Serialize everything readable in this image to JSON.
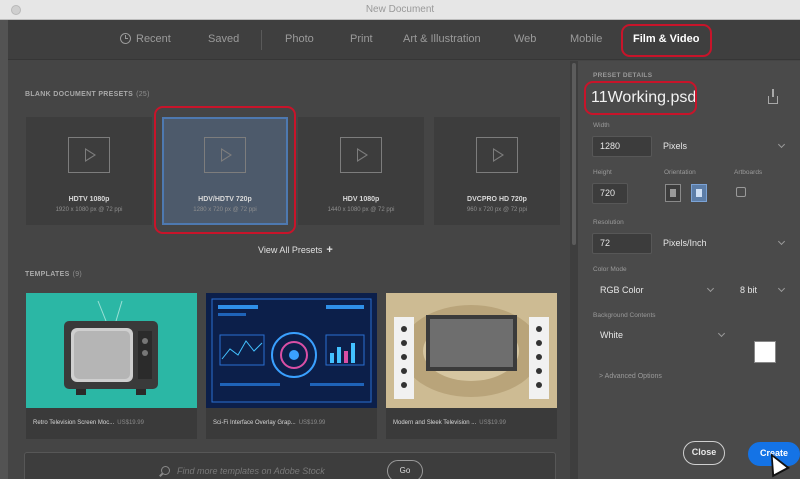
{
  "app": {
    "title": "New Document"
  },
  "tabs": {
    "recent": "Recent",
    "saved": "Saved",
    "photo": "Photo",
    "print": "Print",
    "art": "Art & Illustration",
    "web": "Web",
    "mobile": "Mobile",
    "film": "Film & Video",
    "active": "Film & Video"
  },
  "presets": {
    "title": "BLANK DOCUMENT PRESETS",
    "count": "(25)",
    "items": [
      {
        "name": "HDTV 1080p",
        "dims": "1920 x 1080 px @ 72 ppi"
      },
      {
        "name": "HDV/HDTV 720p",
        "dims": "1280 x 720 px @ 72 ppi"
      },
      {
        "name": "HDV 1080p",
        "dims": "1440 x 1080 px @ 72 ppi"
      },
      {
        "name": "DVCPRO HD 720p",
        "dims": "960 x 720 px @ 72 ppi"
      }
    ],
    "selected_index": 1,
    "view_all": "View All Presets"
  },
  "templates": {
    "title": "TEMPLATES",
    "count": "(9)",
    "items": [
      {
        "name": "Retro Television Screen Moc...",
        "price": "US$19.99"
      },
      {
        "name": "Sci-Fi Interface Overlay Grap...",
        "price": "US$19.99"
      },
      {
        "name": "Modern and Sleek Television ...",
        "price": "US$19.99"
      }
    ]
  },
  "stock": {
    "placeholder": "Find more templates on Adobe Stock",
    "go_label": "Go"
  },
  "details": {
    "header": "PRESET DETAILS",
    "doc_name": "11Working.psd",
    "width_label": "Width",
    "width_value": "1280",
    "width_unit": "Pixels",
    "height_label": "Height",
    "height_value": "720",
    "orientation_label": "Orientation",
    "orientation": "landscape",
    "artboards_label": "Artboards",
    "artboards_checked": false,
    "resolution_label": "Resolution",
    "resolution_value": "72",
    "resolution_unit": "Pixels/Inch",
    "color_mode_label": "Color Mode",
    "color_mode": "RGB Color",
    "bit_depth": "8 bit",
    "background_label": "Background Contents",
    "background": "White",
    "background_color": "#ffffff",
    "advanced": "Advanced Options"
  },
  "actions": {
    "close": "Close",
    "create": "Create"
  },
  "colors": {
    "accent": "#1473e6",
    "highlight": "#c8142a",
    "selected_border": "#4e79b0"
  }
}
